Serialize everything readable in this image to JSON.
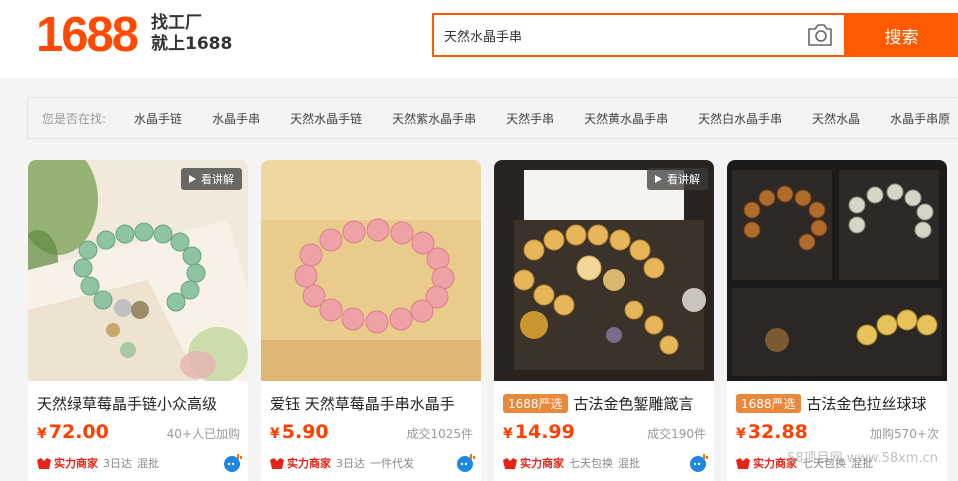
{
  "header": {
    "logo_text": "1688",
    "slogan_line1": "找工厂",
    "slogan_line2": "就上1688",
    "search_value": "天然水晶手串",
    "search_button": "搜索"
  },
  "suggest": {
    "label": "您是否在找:",
    "items": [
      "水晶手链",
      "水晶手串",
      "天然水晶手链",
      "天然紫水晶手串",
      "天然手串",
      "天然黄水晶手串",
      "天然白水晶手串",
      "天然水晶",
      "水晶手串原"
    ]
  },
  "explain_label": "看讲解",
  "products": [
    {
      "tag": "",
      "title": "天然绿草莓晶手链小众高级",
      "yen": "¥",
      "price": "72.00",
      "sold": "40+人已加购",
      "strong": "实力商家",
      "tags": [
        "3日达",
        "混批"
      ]
    },
    {
      "tag": "",
      "title": "爱钰 天然草莓晶手串水晶手",
      "yen": "¥",
      "price": "5.90",
      "sold": "成交1025件",
      "strong": "实力商家",
      "tags": [
        "3日达",
        "一件代发"
      ]
    },
    {
      "tag": "1688严选",
      "title": "古法金色錾雕箴言",
      "yen": "¥",
      "price": "14.99",
      "sold": "成交190件",
      "strong": "实力商家",
      "tags": [
        "七天包换",
        "混批"
      ]
    },
    {
      "tag": "1688严选",
      "title": "古法金色拉丝球球",
      "yen": "¥",
      "price": "32.88",
      "sold": "加购570+次",
      "strong": "实力商家",
      "tags": [
        "七天包换",
        "混批"
      ]
    }
  ],
  "watermark": "58项目网 www.58xm.cn",
  "colors": {
    "brand": "#ff5a00",
    "price": "#ff4000",
    "strong": "#e42418",
    "tag": "#e9873b"
  }
}
